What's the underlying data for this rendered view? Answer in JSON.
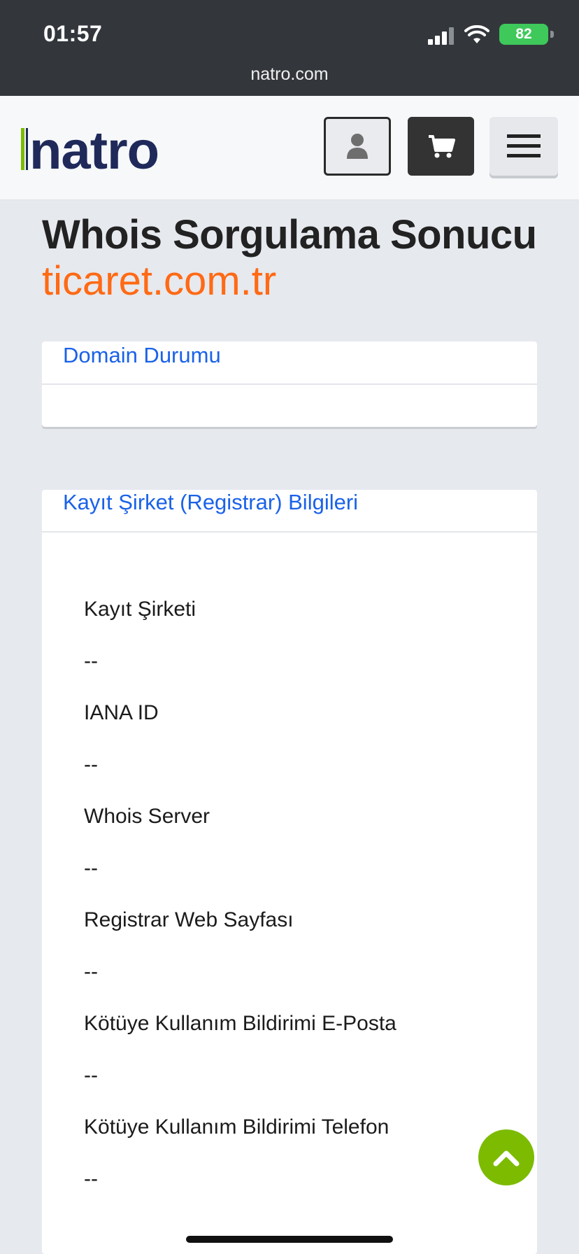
{
  "status_bar": {
    "time": "01:57",
    "battery": "82",
    "url": "natro.com",
    "icons": [
      "signal-icon",
      "wifi-icon",
      "battery-icon"
    ]
  },
  "header": {
    "logo_text": "natro",
    "buttons": [
      "user-icon",
      "cart-icon",
      "hamburger-menu-icon"
    ]
  },
  "page": {
    "title": "Whois Sorgulama Sonucu",
    "domain": "ticaret.com.tr"
  },
  "domain_status": {
    "title": "Domain Durumu"
  },
  "registrar": {
    "title": "Kayıt Şirket (Registrar) Bilgileri",
    "fields": [
      {
        "label": "Kayıt Şirketi",
        "value": "--"
      },
      {
        "label": "IANA ID",
        "value": "--"
      },
      {
        "label": "Whois Server",
        "value": "--"
      },
      {
        "label": "Registrar Web Sayfası",
        "value": "--"
      },
      {
        "label": "Kötüye Kullanım Bildirimi E-Posta",
        "value": "--"
      },
      {
        "label": "Kötüye Kullanım Bildirimi Telefon",
        "value": "--"
      }
    ]
  },
  "colors": {
    "accent_orange": "#ff6a14",
    "link_blue": "#1a62e8",
    "scroll_green": "#7cbb00",
    "logo_navy": "#1f2a5a",
    "logo_green": "#7cbb00"
  }
}
